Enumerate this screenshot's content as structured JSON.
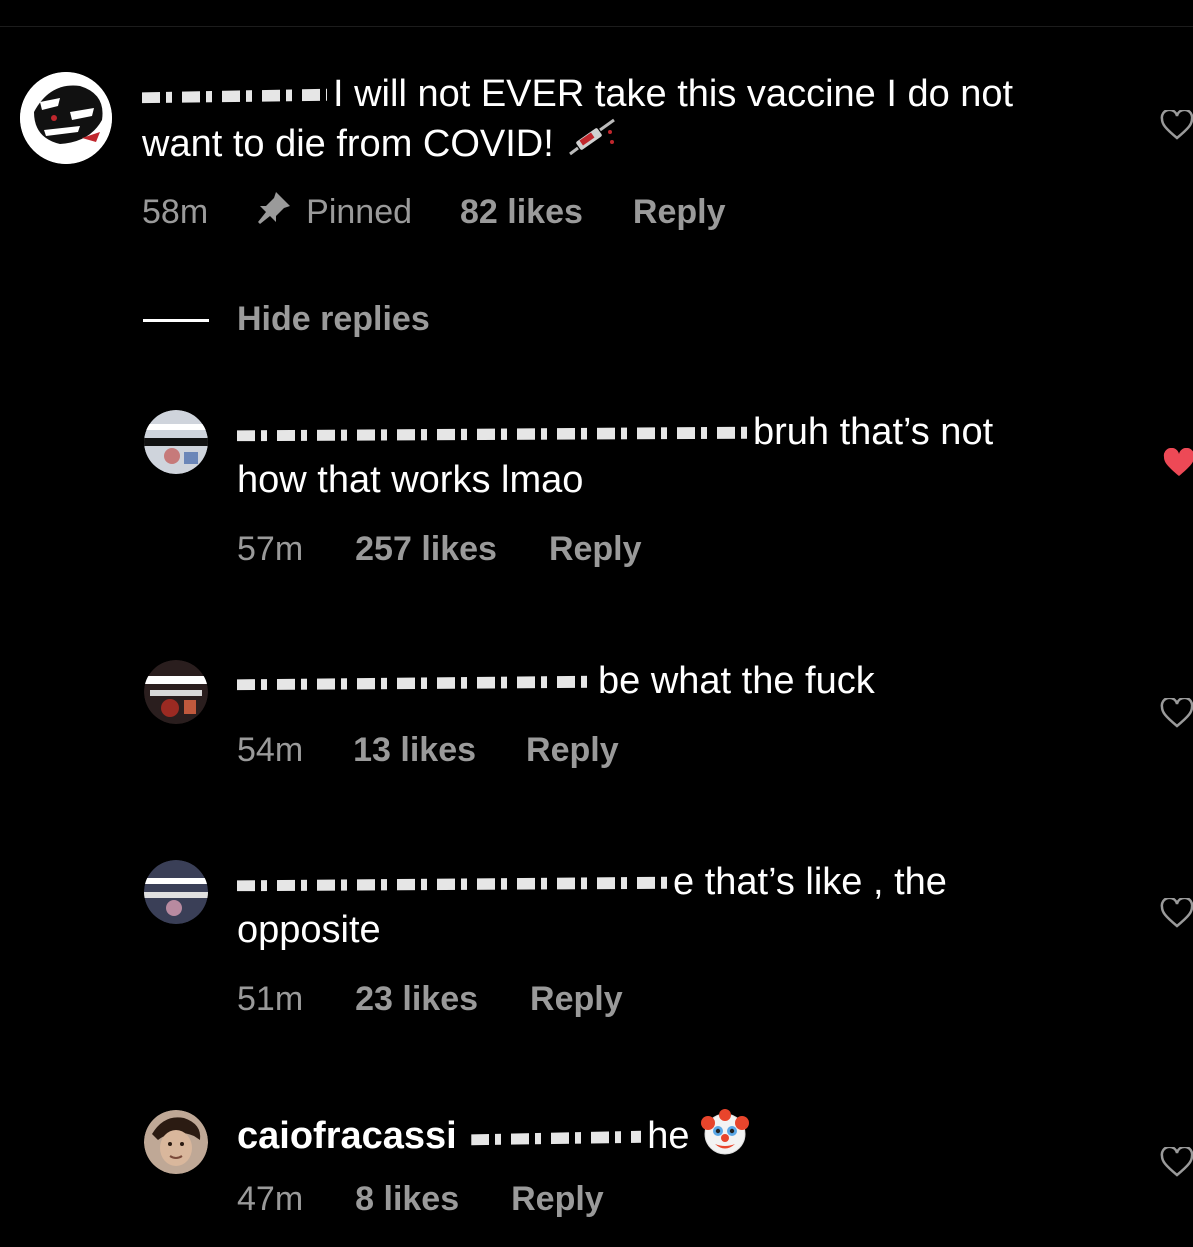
{
  "comments": [
    {
      "text": "I will not EVER take this vaccine I do not want to die from COVID!",
      "time": "58m",
      "pinned": "Pinned",
      "likes": "82 likes",
      "reply": "Reply",
      "liked": false,
      "emoji": "syringe-icon"
    }
  ],
  "hide_replies": "Hide replies",
  "replies": [
    {
      "text_line1": "bruh that’s not",
      "text_line2": "how that works lmao",
      "time": "57m",
      "likes": "257 likes",
      "reply": "Reply",
      "liked": true
    },
    {
      "text_line1": "be what the fuck",
      "time": "54m",
      "likes": "13 likes",
      "reply": "Reply",
      "liked": false
    },
    {
      "text_line1": "e that’s like , the",
      "text_line2": "opposite",
      "time": "51m",
      "likes": "23 likes",
      "reply": "Reply",
      "liked": false
    },
    {
      "username": "caiofracassi",
      "text_line1": "he",
      "time": "47m",
      "likes": "8 likes",
      "reply": "Reply",
      "liked": false,
      "emoji": "clown-face-icon"
    }
  ],
  "colors": {
    "background": "#000000",
    "text": "#ffffff",
    "meta": "#9a9a9a",
    "liked_heart": "#ed4956"
  }
}
